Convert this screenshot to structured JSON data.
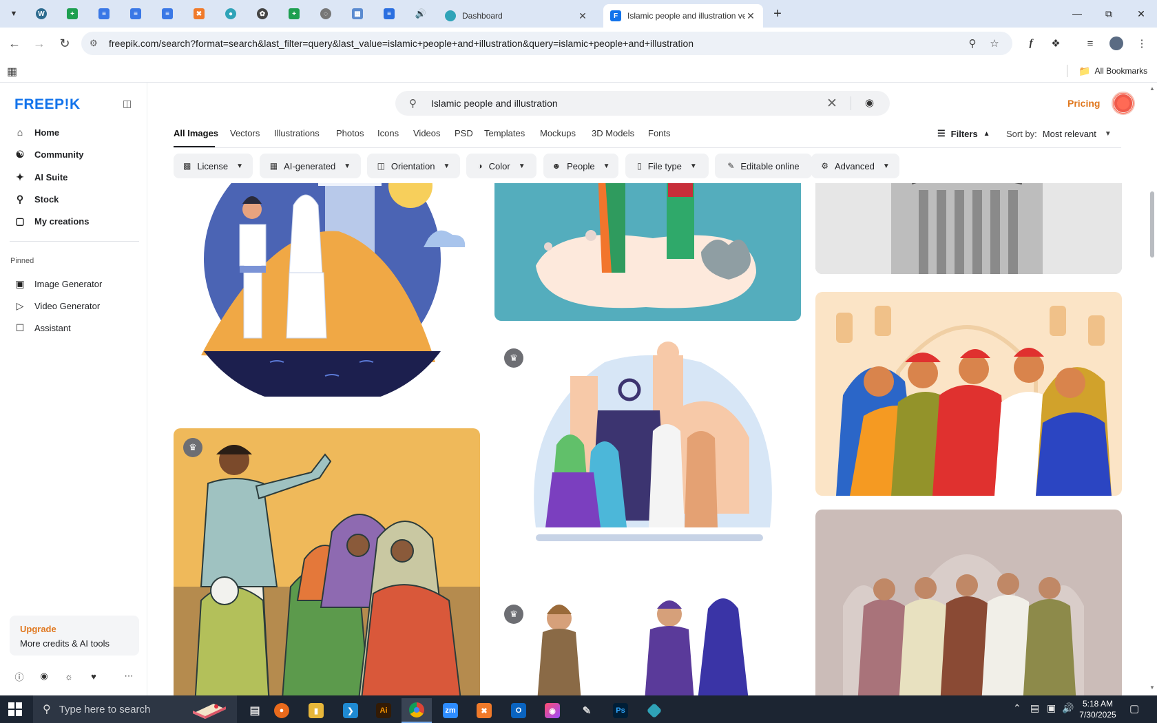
{
  "browser": {
    "tabs": [
      {
        "title": "Dashboard"
      },
      {
        "title": "Islamic people and illustration vectors"
      }
    ],
    "url": "freepik.com/search?format=search&last_filter=query&last_value=islamic+people+and+illustration&query=islamic+people+and+illustration",
    "bookmarks_label": "All Bookmarks"
  },
  "sidebar": {
    "logo": "FREEP!K",
    "nav": [
      {
        "label": "Home",
        "icon": "home-icon"
      },
      {
        "label": "Community",
        "icon": "globe-icon"
      },
      {
        "label": "AI Suite",
        "icon": "sparkle-icon"
      },
      {
        "label": "Stock",
        "icon": "search-icon"
      },
      {
        "label": "My creations",
        "icon": "folder-icon"
      }
    ],
    "pinned_label": "Pinned",
    "pinned": [
      {
        "label": "Image Generator",
        "icon": "image-icon"
      },
      {
        "label": "Video Generator",
        "icon": "video-icon"
      },
      {
        "label": "Assistant",
        "icon": "assistant-icon"
      }
    ],
    "upgrade": {
      "title": "Upgrade",
      "subtitle": "More credits & AI tools"
    }
  },
  "header": {
    "search_value": "Islamic people and illustration",
    "pricing": "Pricing"
  },
  "categories": [
    "All Images",
    "Vectors",
    "Illustrations",
    "Photos",
    "Icons",
    "Videos",
    "PSD",
    "Templates",
    "Mockups",
    "3D Models",
    "Fonts"
  ],
  "active_category": "All Images",
  "filters_label": "Filters",
  "sort": {
    "label": "Sort by:",
    "value": "Most relevant"
  },
  "chips": [
    {
      "label": "License",
      "icon": "license-icon"
    },
    {
      "label": "AI-generated",
      "icon": "ai-icon"
    },
    {
      "label": "Orientation",
      "icon": "orientation-icon"
    },
    {
      "label": "Color",
      "icon": "palette-icon"
    },
    {
      "label": "People",
      "icon": "people-icon"
    },
    {
      "label": "File type",
      "icon": "file-icon"
    },
    {
      "label": "Editable online",
      "icon": "pen-icon"
    },
    {
      "label": "Advanced",
      "icon": "gear-icon"
    }
  ],
  "taskbar": {
    "search_placeholder": "Type here to search",
    "time": "5:18 AM",
    "date": "7/30/2025"
  },
  "colors": {
    "brand": "#1273eb",
    "accent": "#e0781f"
  }
}
